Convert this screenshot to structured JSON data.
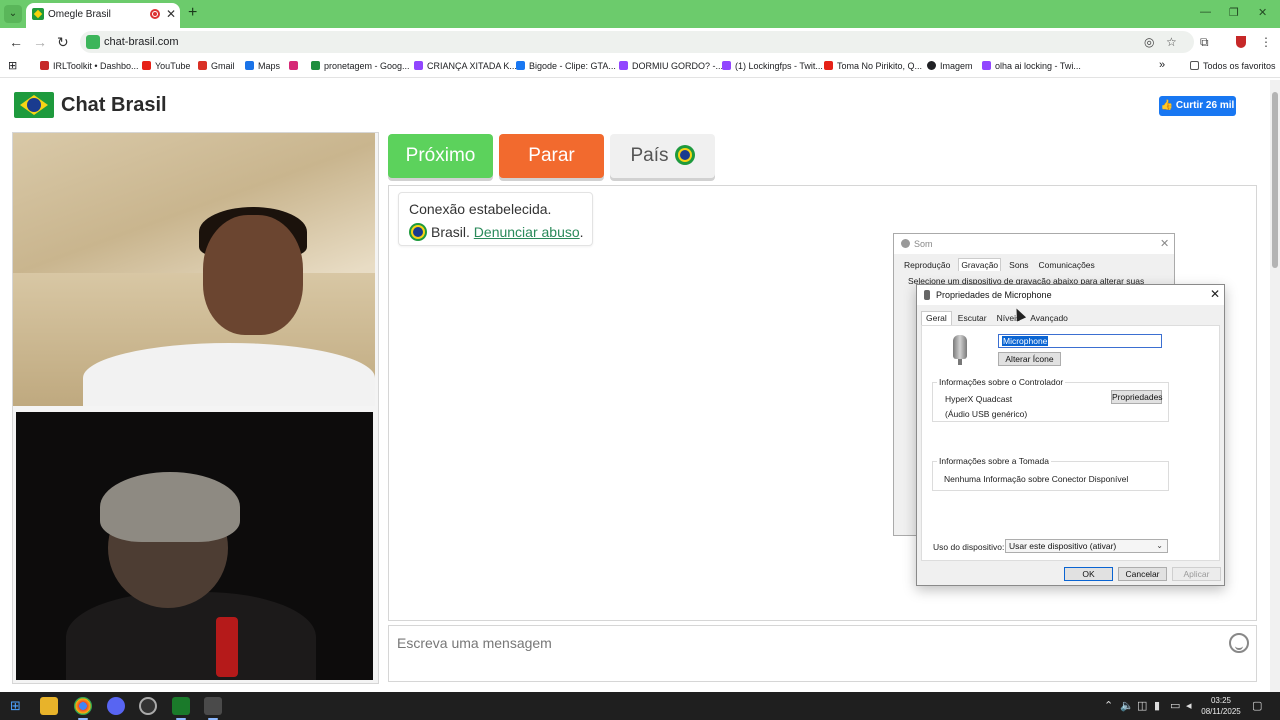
{
  "browser": {
    "tab_title": "Omegle Brasil",
    "tab_close": "✕",
    "new_tab": "+",
    "url": "chat-brasil.com",
    "window_controls": [
      "—",
      "❐",
      "✕"
    ],
    "bookmarks": [
      {
        "label": "IRLToolkit • Dashbo...",
        "color": "#c62828"
      },
      {
        "label": "YouTube",
        "color": "#e62117"
      },
      {
        "label": "Gmail",
        "color": "#d93025"
      },
      {
        "label": "Maps",
        "color": "#1a73e8"
      },
      {
        "label": "pronetagem - Goog...",
        "color": "#1e8e3e"
      },
      {
        "label": "CRIANÇA XITADA K...",
        "color": "#9146ff"
      },
      {
        "label": "Bigode - Clipe: GTA...",
        "color": "#1877f2"
      },
      {
        "label": "DORMIU GORDO? -...",
        "color": "#9146ff"
      },
      {
        "label": "(1) Lockingfps - Twit...",
        "color": "#9146ff"
      },
      {
        "label": "Toma No Pirikito, Q...",
        "color": "#e62117"
      },
      {
        "label": "Imagem",
        "color": "#202124"
      },
      {
        "label": "olha ai locking - Twi...",
        "color": "#9146ff"
      }
    ],
    "bookmarks_more": "»",
    "all_favorites": "Todos os favoritos"
  },
  "site": {
    "brand": "Chat Brasil",
    "like_button": "👍 Curtir 26 mil",
    "buttons": {
      "next": "Próximo",
      "stop": "Parar",
      "country": "País"
    },
    "status": {
      "line1": "Conexão estabelecida.",
      "country": "Brasil.",
      "report_link": "Denunciar abuso",
      "period": "."
    },
    "message_placeholder": "Escreva uma mensagem"
  },
  "sound_dialog": {
    "title": "Som",
    "tabs": [
      "Reprodução",
      "Gravação",
      "Sons",
      "Comunicações"
    ],
    "active_tab": "Gravação",
    "description": "Selecione um dispositivo de gravação abaixo para alterar suas"
  },
  "mic_dialog": {
    "title": "Propriedades de Microphone",
    "tabs": [
      "Geral",
      "Escutar",
      "Níveis",
      "Avançado"
    ],
    "active_tab": "Geral",
    "name_value": "Microphone",
    "change_icon": "Alterar Ícone",
    "controller_group": "Informações sobre o Controlador",
    "controller_name": "HyperX Quadcast",
    "controller_sub": "(Áudio USB genérico)",
    "properties_button": "Propriedades",
    "jack_group": "Informações sobre a Tomada",
    "jack_info": "Nenhuma Informação sobre Conector Disponível",
    "usage_label": "Uso do dispositivo:",
    "usage_value": "Usar este dispositivo (ativar)",
    "ok": "OK",
    "cancel": "Cancelar",
    "apply": "Aplicar"
  },
  "taskbar": {
    "time": "03:25",
    "date": "08/11/2025"
  }
}
